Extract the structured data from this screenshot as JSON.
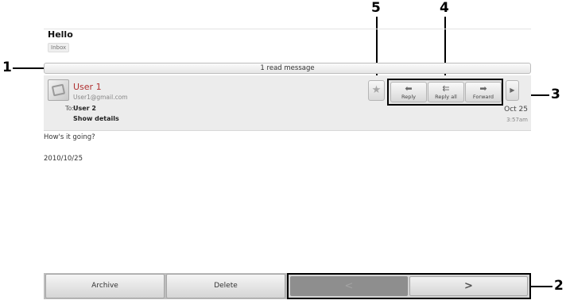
{
  "message": {
    "subject": "Hello",
    "label": "Inbox",
    "read_summary": "1 read message",
    "sender_name": "User 1",
    "sender_email": "User1@gmail.com",
    "to_label": "To:",
    "to_value": "User 2",
    "show_details": "Show details",
    "date": "Oct 25",
    "time": "3:57am",
    "body_lines": [
      "How's it going?",
      "2010/10/25"
    ]
  },
  "actions": {
    "star_icon": "star-icon",
    "reply_label": "Reply",
    "reply_all_label": "Reply all",
    "forward_label": "Forward",
    "more_icon": "chevron-right-icon"
  },
  "bottom": {
    "archive_label": "Archive",
    "delete_label": "Delete",
    "prev_icon": "chevron-left-icon",
    "next_icon": "chevron-right-icon"
  },
  "callouts": [
    "1",
    "2",
    "3",
    "4",
    "5"
  ]
}
